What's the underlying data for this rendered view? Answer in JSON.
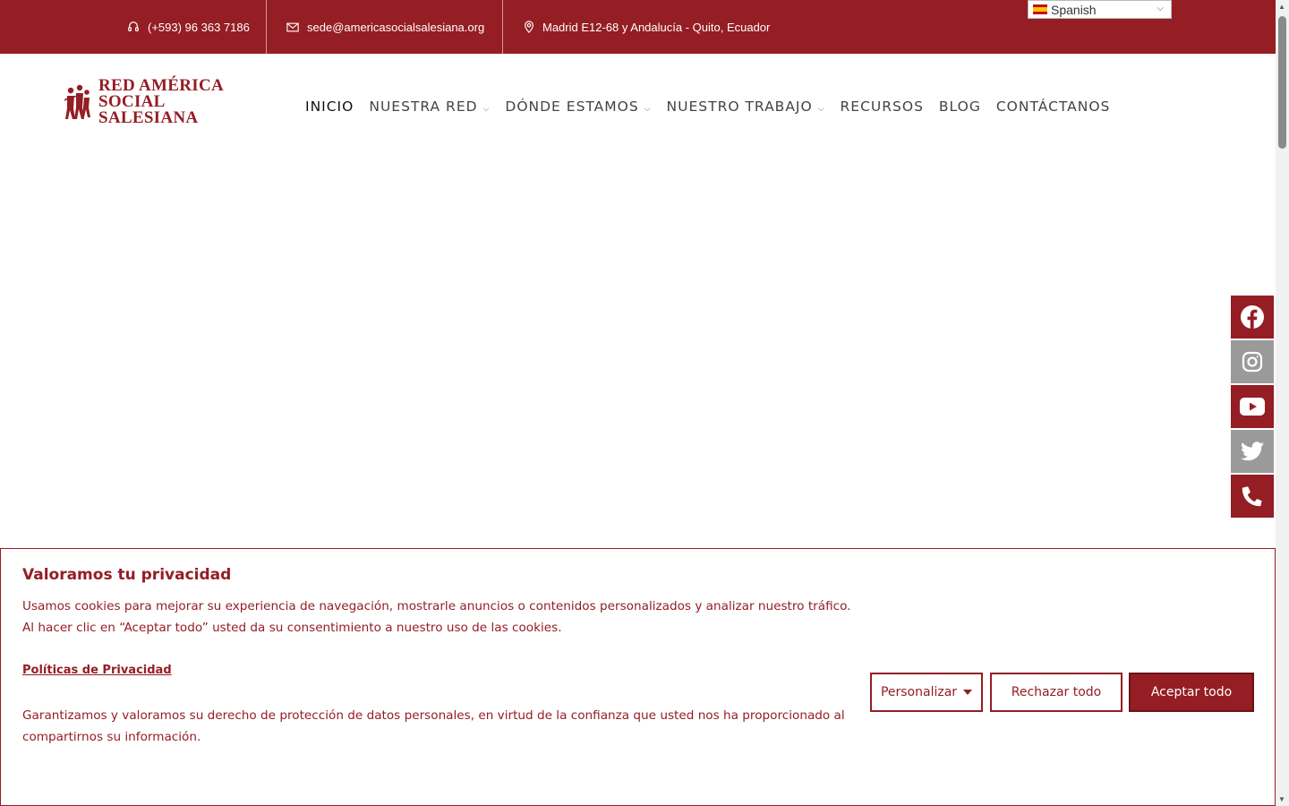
{
  "topbar": {
    "phone": "(+593) 96 363 7186",
    "email": "sede@americasocialsalesiana.org",
    "address": "Madrid E12-68 y Andalucía - Quito, Ecuador"
  },
  "language": {
    "selected": "Spanish"
  },
  "logo": {
    "line1": "RED AMÉRICA",
    "line2": "SOCIAL SALESIANA"
  },
  "nav": {
    "items": [
      {
        "label": "INICIO",
        "has_dropdown": false,
        "active": true
      },
      {
        "label": "NUESTRA RED",
        "has_dropdown": true
      },
      {
        "label": "DÓNDE ESTAMOS",
        "has_dropdown": true
      },
      {
        "label": "NUESTRO TRABAJO",
        "has_dropdown": true
      },
      {
        "label": "RECURSOS",
        "has_dropdown": false
      },
      {
        "label": "BLOG",
        "has_dropdown": false
      },
      {
        "label": "CONTÁCTANOS",
        "has_dropdown": false
      }
    ]
  },
  "social": [
    "facebook-icon",
    "instagram-icon",
    "youtube-icon",
    "twitter-icon",
    "phone-icon"
  ],
  "cookie": {
    "title": "Valoramos tu privacidad",
    "text": "Usamos cookies para mejorar su experiencia de navegación, mostrarle anuncios o contenidos personalizados y analizar nuestro tráfico. Al hacer clic en “Aceptar todo” usted da su consentimiento a nuestro uso de las cookies.",
    "policy_link": "Políticas de Privacidad",
    "text2": "Garantizamos y valoramos su derecho de protección de datos personales, en virtud de la confianza que usted nos ha proporcionado al compartirnos su información.",
    "customize": "Personalizar",
    "reject": "Rechazar todo",
    "accept": "Aceptar todo"
  },
  "colors": {
    "brand": "#951d24",
    "social_grey": "#9a9a9a"
  }
}
